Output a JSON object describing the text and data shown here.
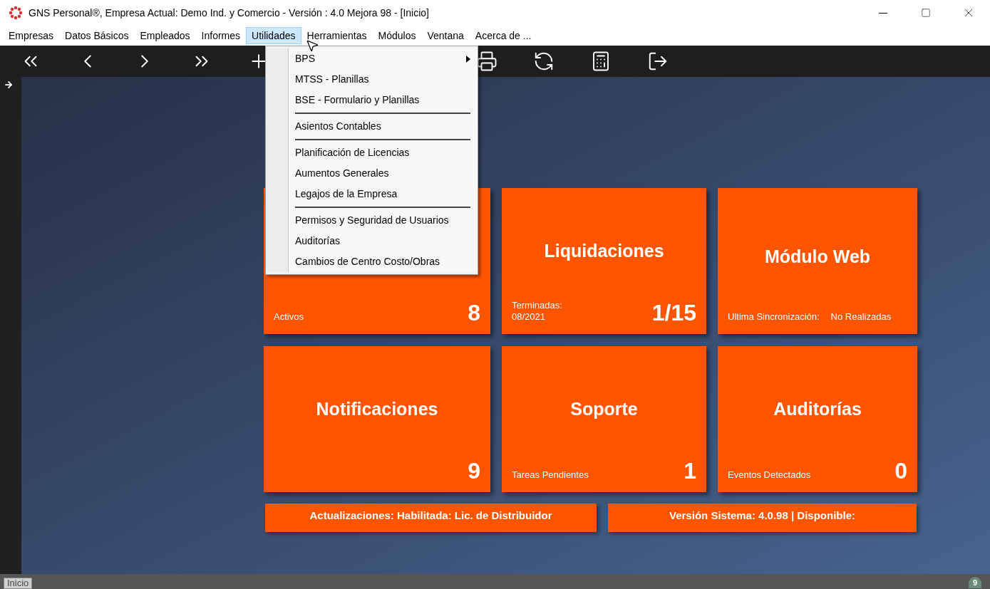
{
  "window": {
    "title": "GNS Personal®, Empresa Actual: Demo Ind. y Comercio - Versión : 4.0 Mejora 98 - [Inicio]"
  },
  "menubar": [
    {
      "label": "Empresas",
      "selected": false
    },
    {
      "label": "Datos Básicos",
      "selected": false
    },
    {
      "label": "Empleados",
      "selected": false
    },
    {
      "label": "Informes",
      "selected": false
    },
    {
      "label": "Utilidades",
      "selected": true
    },
    {
      "label": "Herramientas",
      "selected": false
    },
    {
      "label": "Módulos",
      "selected": false
    },
    {
      "label": "Ventana",
      "selected": false
    },
    {
      "label": "Acerca de ..."
    }
  ],
  "dropdown": {
    "groups": [
      [
        {
          "label": "BPS",
          "submenu": true
        },
        {
          "label": "MTSS - Planillas",
          "submenu": false
        },
        {
          "label": "BSE - Formulario y Planillas",
          "submenu": false
        }
      ],
      [
        {
          "label": "Asientos Contables",
          "submenu": false
        }
      ],
      [
        {
          "label": "Planificación de Licencias",
          "submenu": false
        },
        {
          "label": "Aumentos Generales",
          "submenu": false
        },
        {
          "label": "Legajos de la Empresa",
          "submenu": false
        }
      ],
      [
        {
          "label": "Permisos y Seguridad de Usuarios",
          "submenu": false
        },
        {
          "label": "Auditorías",
          "submenu": false
        },
        {
          "label": "Cambios de Centro Costo/Obras",
          "submenu": false
        }
      ]
    ]
  },
  "tiles": [
    {
      "footer": [
        "Activos"
      ],
      "value": "8"
    },
    {
      "title": "Liquidaciones",
      "footer": [
        "Terminadas:\n08/2021"
      ],
      "value": "1/15"
    },
    {
      "title": "Módulo Web",
      "footer": [
        "Ultima Sincronización:",
        "No Realizadas"
      ]
    },
    {
      "title": "Notificaciones",
      "value": "9"
    },
    {
      "title": "Soporte",
      "footer": [
        "Tareas Pendientes"
      ],
      "value": "1"
    },
    {
      "title": "Auditorías",
      "footer": [
        "Eventos Detectados"
      ],
      "value": "0"
    }
  ],
  "info_bars": [
    "Actualizaciones: Habilitada: Lic. de Distribuidor",
    "Versión Sistema: 4.0.98 | Disponible:"
  ],
  "status_bar": {
    "tab": "Inicio",
    "badge": "9"
  }
}
